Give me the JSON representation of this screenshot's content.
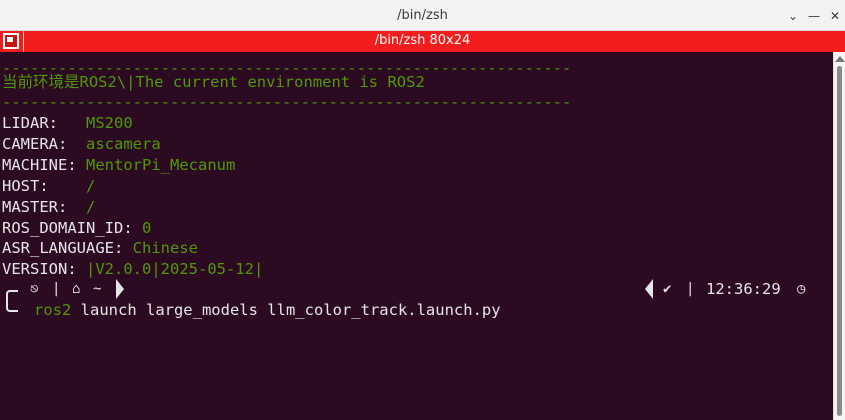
{
  "window": {
    "title": "/bin/zsh",
    "chevron_icon": "chevron-down-icon",
    "minimize_icon": "minimize-icon",
    "close_icon": "close-icon"
  },
  "tab": {
    "title": "/bin/zsh 80x24",
    "icon": "terminal-tab-icon"
  },
  "terminal": {
    "divider": "-------------------------------------------------------------",
    "banner": "当前环境是ROS2\\|The current environment is ROS2",
    "env": [
      {
        "label": "LIDAR:   ",
        "value": "MS200"
      },
      {
        "label": "CAMERA:  ",
        "value": "ascamera"
      },
      {
        "label": "MACHINE: ",
        "value": "MentorPi_Mecanum"
      },
      {
        "label": "HOST:    ",
        "value": "/"
      },
      {
        "label": "MASTER:  ",
        "value": "/"
      },
      {
        "label": "ROS_DOMAIN_ID: ",
        "value": "0"
      },
      {
        "label": "ASR_LANGUAGE: ",
        "value": "Chinese"
      },
      {
        "label": "VERSION: ",
        "value": "|V2.0.0|2025-05-12|"
      }
    ],
    "prompt": {
      "os_icon": "linux-icon",
      "home_icon": "home-icon",
      "path": "~",
      "status_icon": "check-icon",
      "time": "12:36:29",
      "clock_icon": "clock-icon",
      "command_name": "ros2",
      "command_args": " launch large_models llm_color_track.launch.py"
    }
  },
  "colors": {
    "terminal_bg": "#2c0a22",
    "green": "#4e9a06",
    "tab_red": "#f21d1d"
  }
}
